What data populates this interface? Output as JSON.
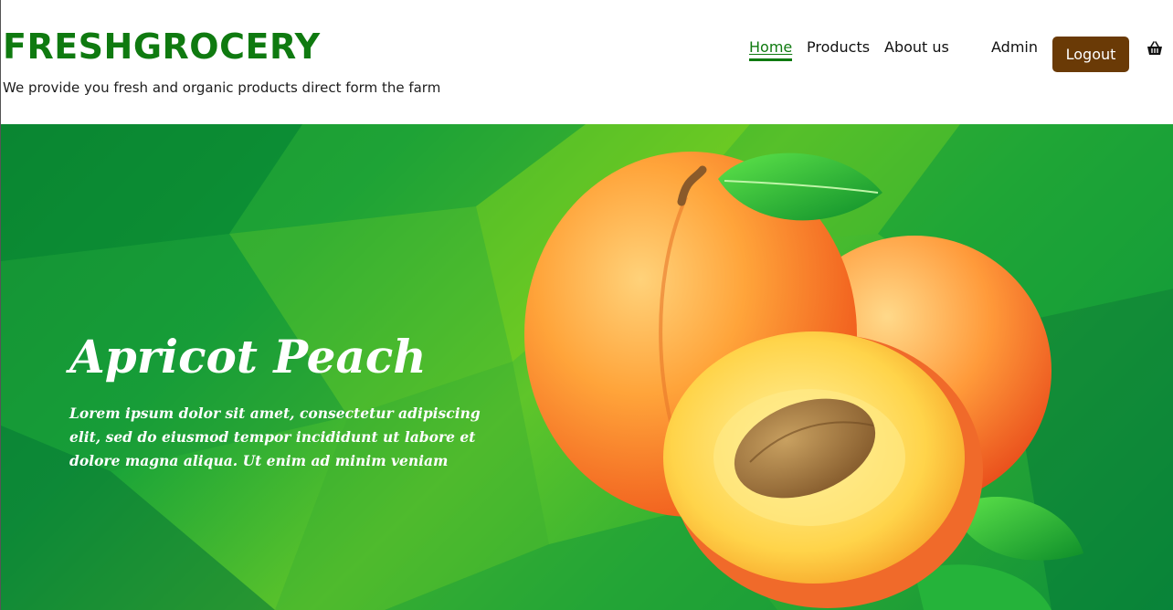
{
  "header": {
    "brand": "FRESHGROCERY",
    "tagline": "We provide you fresh and organic products direct form the farm"
  },
  "nav": {
    "items": [
      {
        "label": "Home",
        "active": true
      },
      {
        "label": "Products",
        "active": false
      },
      {
        "label": "About us",
        "active": false
      },
      {
        "label": "Admin",
        "active": false
      }
    ],
    "logout_label": "Logout",
    "cart_icon": "basket-icon"
  },
  "hero": {
    "title": "Apricot Peach",
    "text": "Lorem ipsum dolor sit amet, consectetur adipiscing elit, sed do eiusmod tempor incididunt ut labore et dolore magna aliqua. Ut enim ad minim veniam",
    "image_icon": "apricot-peach-image"
  },
  "colors": {
    "brand": "#0f7a10",
    "logout_bg": "#6a3a06",
    "hero_green": "#12a03a"
  }
}
